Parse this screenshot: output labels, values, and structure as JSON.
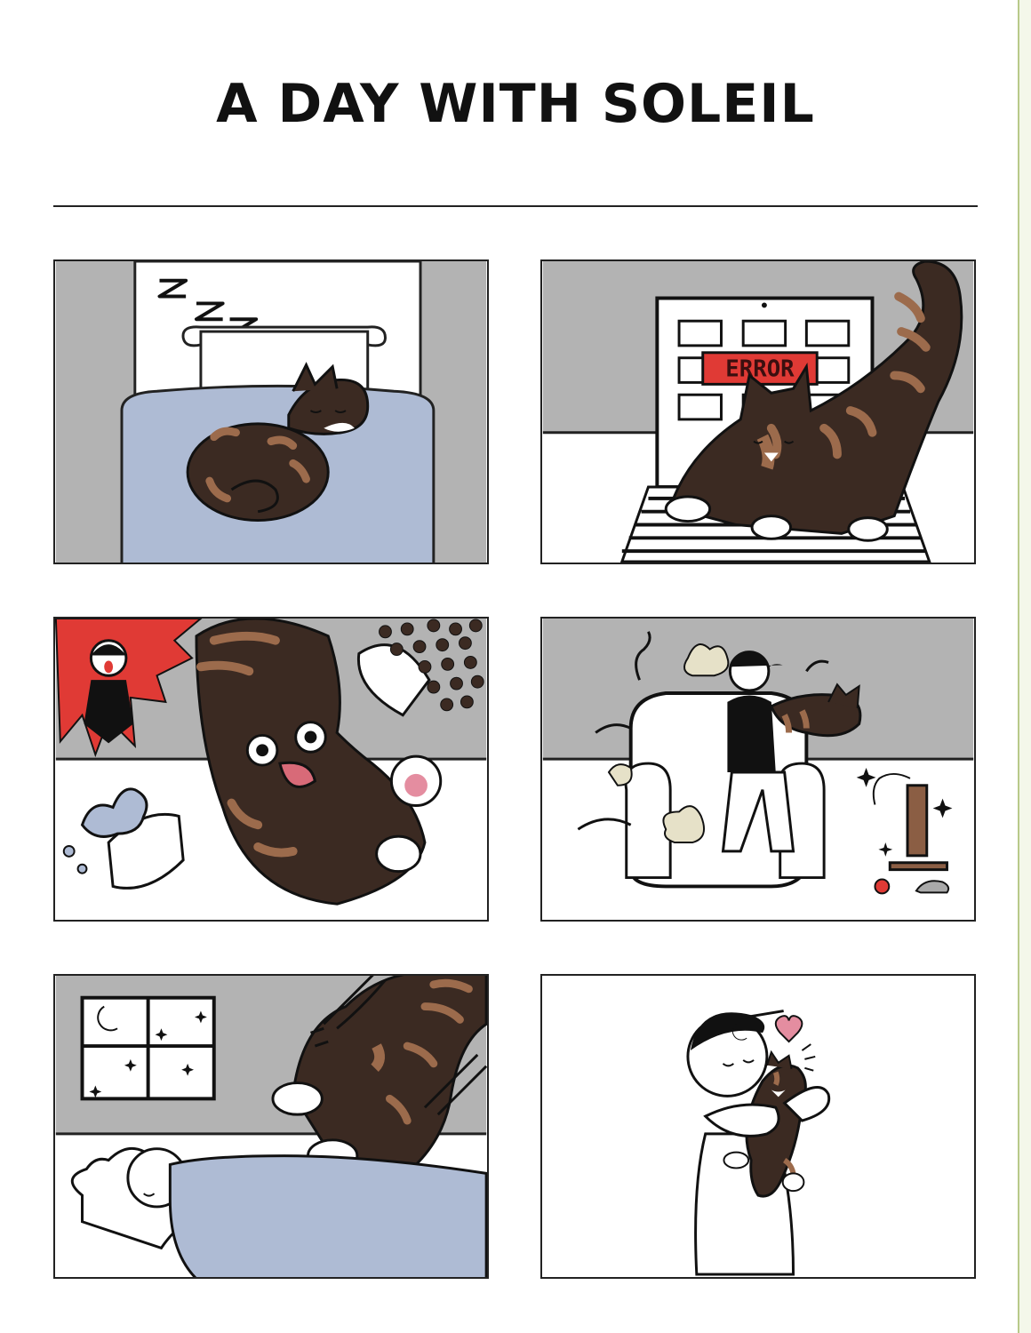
{
  "comic": {
    "title": "A DAY WITH SOLEIL",
    "panels": [
      {
        "id": "panel-1"
      },
      {
        "id": "panel-2",
        "screen_text": "ERROR"
      },
      {
        "id": "panel-3"
      },
      {
        "id": "panel-4"
      },
      {
        "id": "panel-5"
      },
      {
        "id": "panel-6"
      }
    ]
  },
  "colors": {
    "cat_dark": "#3b2a22",
    "cat_stripe": "#9c6b4c",
    "wall_gray": "#b3b3b3",
    "blanket_blue": "#aebbd4",
    "alert_red": "#e03a35",
    "page_edge_green": "#b8c98a"
  }
}
